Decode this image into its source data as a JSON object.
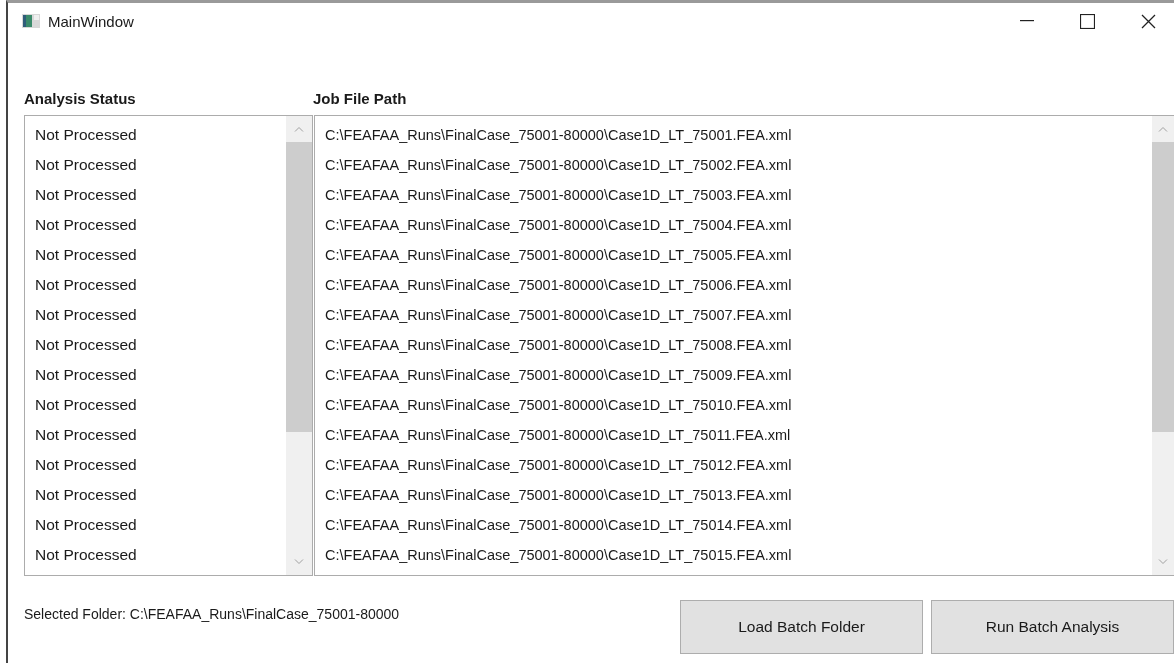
{
  "window": {
    "title": "MainWindow"
  },
  "status_header": "Analysis Status",
  "path_header": "Job File Path",
  "statuses": [
    "Not Processed",
    "Not Processed",
    "Not Processed",
    "Not Processed",
    "Not Processed",
    "Not Processed",
    "Not Processed",
    "Not Processed",
    "Not Processed",
    "Not Processed",
    "Not Processed",
    "Not Processed",
    "Not Processed",
    "Not Processed",
    "Not Processed"
  ],
  "paths": [
    "C:\\FEAFAA_Runs\\FinalCase_75001-80000\\Case1D_LT_75001.FEA.xml",
    "C:\\FEAFAA_Runs\\FinalCase_75001-80000\\Case1D_LT_75002.FEA.xml",
    "C:\\FEAFAA_Runs\\FinalCase_75001-80000\\Case1D_LT_75003.FEA.xml",
    "C:\\FEAFAA_Runs\\FinalCase_75001-80000\\Case1D_LT_75004.FEA.xml",
    "C:\\FEAFAA_Runs\\FinalCase_75001-80000\\Case1D_LT_75005.FEA.xml",
    "C:\\FEAFAA_Runs\\FinalCase_75001-80000\\Case1D_LT_75006.FEA.xml",
    "C:\\FEAFAA_Runs\\FinalCase_75001-80000\\Case1D_LT_75007.FEA.xml",
    "C:\\FEAFAA_Runs\\FinalCase_75001-80000\\Case1D_LT_75008.FEA.xml",
    "C:\\FEAFAA_Runs\\FinalCase_75001-80000\\Case1D_LT_75009.FEA.xml",
    "C:\\FEAFAA_Runs\\FinalCase_75001-80000\\Case1D_LT_75010.FEA.xml",
    "C:\\FEAFAA_Runs\\FinalCase_75001-80000\\Case1D_LT_75011.FEA.xml",
    "C:\\FEAFAA_Runs\\FinalCase_75001-80000\\Case1D_LT_75012.FEA.xml",
    "C:\\FEAFAA_Runs\\FinalCase_75001-80000\\Case1D_LT_75013.FEA.xml",
    "C:\\FEAFAA_Runs\\FinalCase_75001-80000\\Case1D_LT_75014.FEA.xml",
    "C:\\FEAFAA_Runs\\FinalCase_75001-80000\\Case1D_LT_75015.FEA.xml"
  ],
  "selected_folder": "Selected Folder: C:\\FEAFAA_Runs\\FinalCase_75001-80000",
  "buttons": [
    "Load Batch Folder",
    "Run Batch Analysis"
  ]
}
